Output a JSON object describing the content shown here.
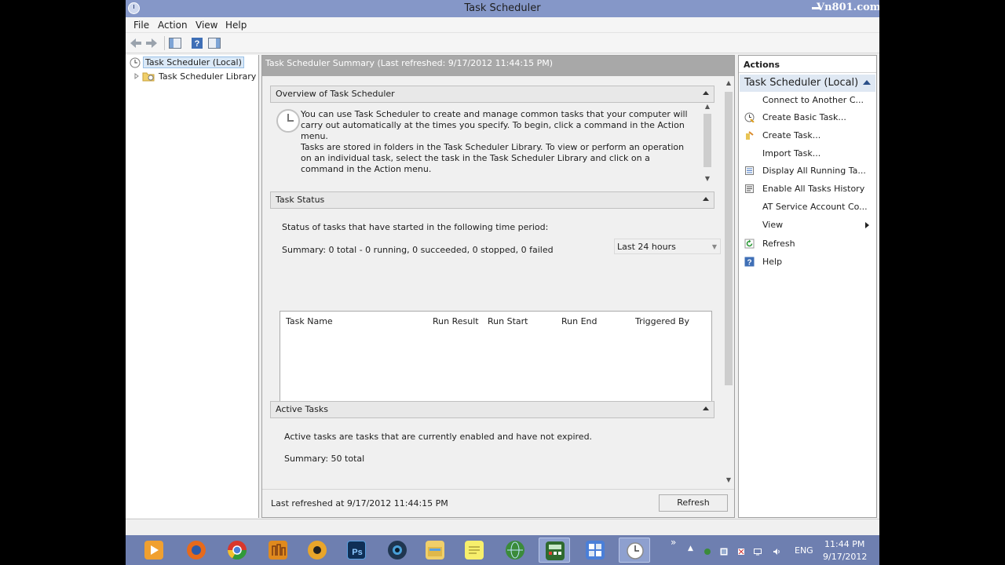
{
  "window": {
    "title": "Task Scheduler",
    "watermark": "Vn801.com"
  },
  "menu": {
    "items": [
      "File",
      "Action",
      "View",
      "Help"
    ]
  },
  "tree": {
    "root": "Task Scheduler (Local)",
    "library": "Task Scheduler Library"
  },
  "center": {
    "header": "Task Scheduler Summary (Last refreshed: 9/17/2012 11:44:15 PM)",
    "overview": {
      "title": "Overview of Task Scheduler",
      "para1": "You can use Task Scheduler to create and manage common tasks that your computer will carry out automatically at the times you specify. To begin, click a command in the Action menu.",
      "para2": "Tasks are stored in folders in the Task Scheduler Library. To view or perform an operation on an individual task, select the task in the Task Scheduler Library and click on a command in the Action menu."
    },
    "task_status": {
      "title": "Task Status",
      "period_label": "Status of tasks that have started in the following time period:",
      "period_value": "Last 24 hours",
      "summary": "Summary: 0 total - 0 running, 0 succeeded, 0 stopped, 0 failed",
      "columns": [
        "Task Name",
        "Run Result",
        "Run Start",
        "Run End",
        "Triggered By"
      ]
    },
    "active_tasks": {
      "title": "Active Tasks",
      "description": "Active tasks are tasks that are currently enabled and have not expired.",
      "summary": "Summary: 50 total"
    },
    "footer": {
      "last_refreshed": "Last refreshed at 9/17/2012 11:44:15 PM",
      "refresh_button": "Refresh"
    }
  },
  "actions": {
    "header": "Actions",
    "group": "Task Scheduler (Local)",
    "items": [
      {
        "label": "Connect to Another C...",
        "icon": "none"
      },
      {
        "label": "Create Basic Task...",
        "icon": "create-basic-task-icon"
      },
      {
        "label": "Create Task...",
        "icon": "create-task-icon"
      },
      {
        "label": "Import Task...",
        "icon": "none"
      },
      {
        "label": "Display All Running Ta...",
        "icon": "running-tasks-icon"
      },
      {
        "label": "Enable All Tasks History",
        "icon": "history-icon"
      },
      {
        "label": "AT Service Account Co...",
        "icon": "none"
      },
      {
        "label": "View",
        "icon": "none",
        "submenu": true
      },
      {
        "label": "Refresh",
        "icon": "refresh-icon"
      },
      {
        "label": "Help",
        "icon": "help-icon"
      }
    ]
  },
  "taskbar": {
    "language": "ENG",
    "time": "11:44 PM",
    "date": "9/17/2012",
    "apps": [
      "media-player",
      "firefox",
      "chrome",
      "music",
      "media-center",
      "photoshop",
      "camera",
      "file-explorer",
      "sticky-notes",
      "network-globe",
      "calculator",
      "control-panel",
      "task-scheduler"
    ]
  },
  "colors": {
    "titlebar": "#8597c8",
    "taskbar": "#6e7fb0",
    "selection": "#dbe9f7",
    "actions_group": "#dfe8f3"
  }
}
